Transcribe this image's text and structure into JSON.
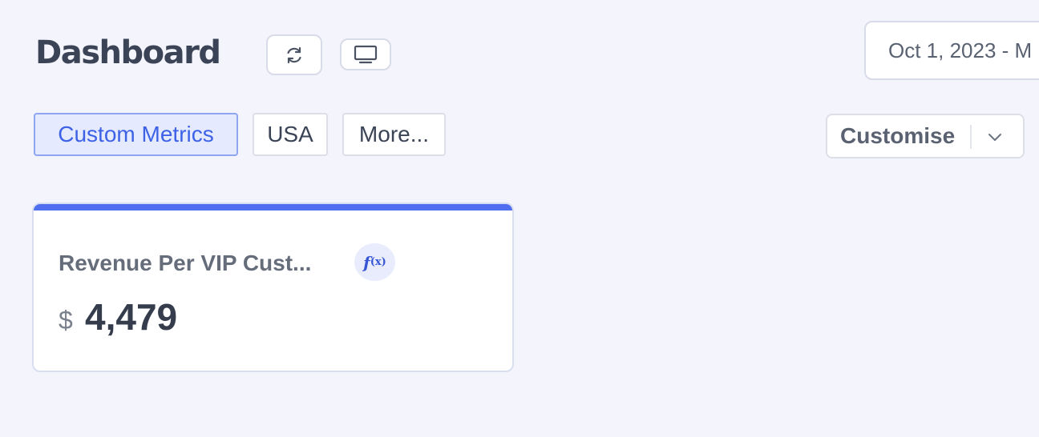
{
  "header": {
    "title": "Dashboard",
    "refresh_icon": "refresh-icon",
    "display_icon": "monitor-icon",
    "date_range": "Oct 1, 2023 - M"
  },
  "filters": {
    "chips": [
      {
        "label": "Custom Metrics",
        "active": true
      },
      {
        "label": "USA",
        "active": false
      },
      {
        "label": "More...",
        "active": false
      }
    ],
    "customise_label": "Customise",
    "customise_icon": "chevron-down-icon"
  },
  "metric_card": {
    "title": "Revenue Per VIP Cust...",
    "badge_icon": "function-icon",
    "badge_text": "f",
    "badge_sub": "(x)",
    "currency": "$",
    "value": "4,479",
    "accent_color": "#4f6ef0"
  },
  "colors": {
    "background": "#f4f4fd",
    "accent": "#3d62e6",
    "chip_active_bg": "#e5eaff"
  }
}
